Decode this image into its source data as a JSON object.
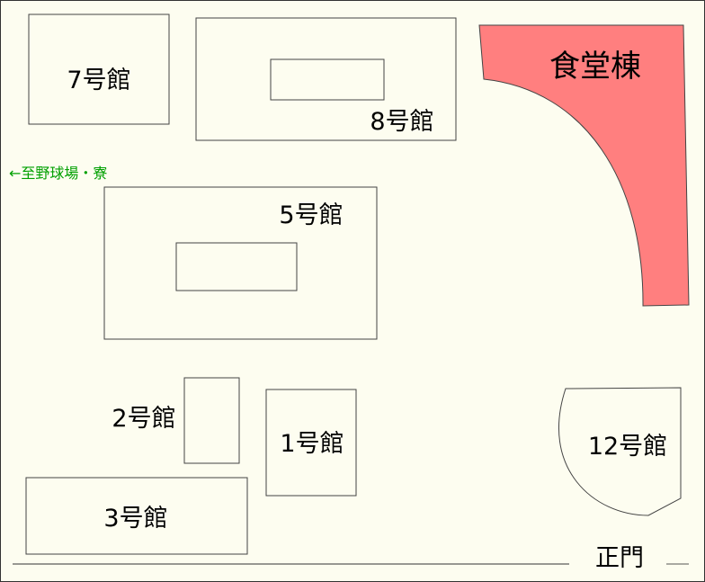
{
  "colors": {
    "background": "#fdfdf0",
    "cafeteria": "#ff7f7f",
    "direction_text": "#00a000"
  },
  "buildings": {
    "b7": "7号館",
    "b8": "8号館",
    "cafeteria": "食堂棟",
    "b5": "5号館",
    "b2": "2号館",
    "b1": "1号館",
    "b3": "3号館",
    "b12": "12号館"
  },
  "direction": "←至野球場・寮",
  "gate": "正門"
}
